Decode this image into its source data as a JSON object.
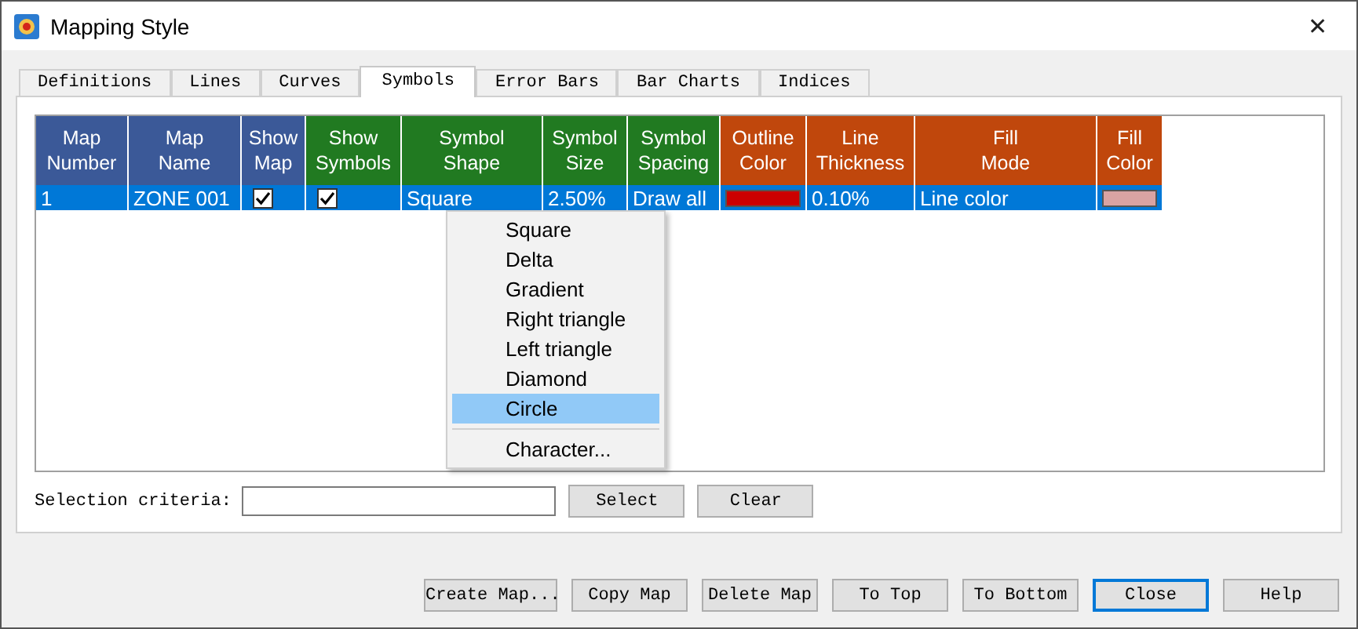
{
  "window": {
    "title": "Mapping Style",
    "close": "✕"
  },
  "tabs": [
    {
      "label": "Definitions",
      "selected": false
    },
    {
      "label": "Lines",
      "selected": false
    },
    {
      "label": "Curves",
      "selected": false
    },
    {
      "label": "Symbols",
      "selected": true
    },
    {
      "label": "Error Bars",
      "selected": false
    },
    {
      "label": "Bar Charts",
      "selected": false
    },
    {
      "label": "Indices",
      "selected": false
    }
  ],
  "table": {
    "columns": [
      {
        "label": "Map Number",
        "color": "#3b5998"
      },
      {
        "label": "Map Name",
        "color": "#3b5998"
      },
      {
        "label": "Show Map",
        "color": "#3b5998"
      },
      {
        "label": "Show Symbols",
        "color": "#217a21"
      },
      {
        "label": "Symbol Shape",
        "color": "#217a21"
      },
      {
        "label": "Symbol Size",
        "color": "#217a21"
      },
      {
        "label": "Symbol Spacing",
        "color": "#217a21"
      },
      {
        "label": "Outline Color",
        "color": "#c0470c"
      },
      {
        "label": "Line Thickness",
        "color": "#c0470c"
      },
      {
        "label": "Fill Mode",
        "color": "#c0470c"
      },
      {
        "label": "Fill Color",
        "color": "#c0470c"
      }
    ],
    "rows": [
      {
        "selected": true,
        "cells": [
          {
            "kind": "text",
            "text": "1"
          },
          {
            "kind": "text",
            "text": "ZONE 001"
          },
          {
            "kind": "check",
            "checked": true
          },
          {
            "kind": "check",
            "checked": true
          },
          {
            "kind": "text",
            "text": "Square"
          },
          {
            "kind": "text",
            "text": "2.50%"
          },
          {
            "kind": "text",
            "text": "Draw all"
          },
          {
            "kind": "swatch",
            "color": "#cc0000"
          },
          {
            "kind": "text",
            "text": "0.10%"
          },
          {
            "kind": "text",
            "text": "Line color"
          },
          {
            "kind": "swatch",
            "color": "#d9a3a3"
          }
        ]
      }
    ]
  },
  "menu": [
    {
      "kind": "item",
      "label": "Square",
      "selected": false
    },
    {
      "kind": "item",
      "label": "Delta",
      "selected": false
    },
    {
      "kind": "item",
      "label": "Gradient",
      "selected": false
    },
    {
      "kind": "item",
      "label": "Right triangle",
      "selected": false
    },
    {
      "kind": "item",
      "label": "Left triangle",
      "selected": false
    },
    {
      "kind": "item",
      "label": "Diamond",
      "selected": false
    },
    {
      "kind": "item",
      "label": "Circle",
      "selected": true
    },
    {
      "kind": "separator"
    },
    {
      "kind": "item",
      "label": "Character...",
      "selected": false
    }
  ],
  "selection": {
    "label": "Selection criteria:",
    "buttons": [
      "Select",
      "Clear"
    ]
  },
  "buttons": [
    {
      "label": "Create Map...",
      "default": false
    },
    {
      "label": "Copy Map",
      "default": false
    },
    {
      "label": "Delete Map",
      "default": false
    },
    {
      "label": "To Top",
      "default": false
    },
    {
      "label": "To Bottom",
      "default": false
    },
    {
      "label": "Close",
      "default": true
    },
    {
      "label": "Help",
      "default": false
    }
  ]
}
